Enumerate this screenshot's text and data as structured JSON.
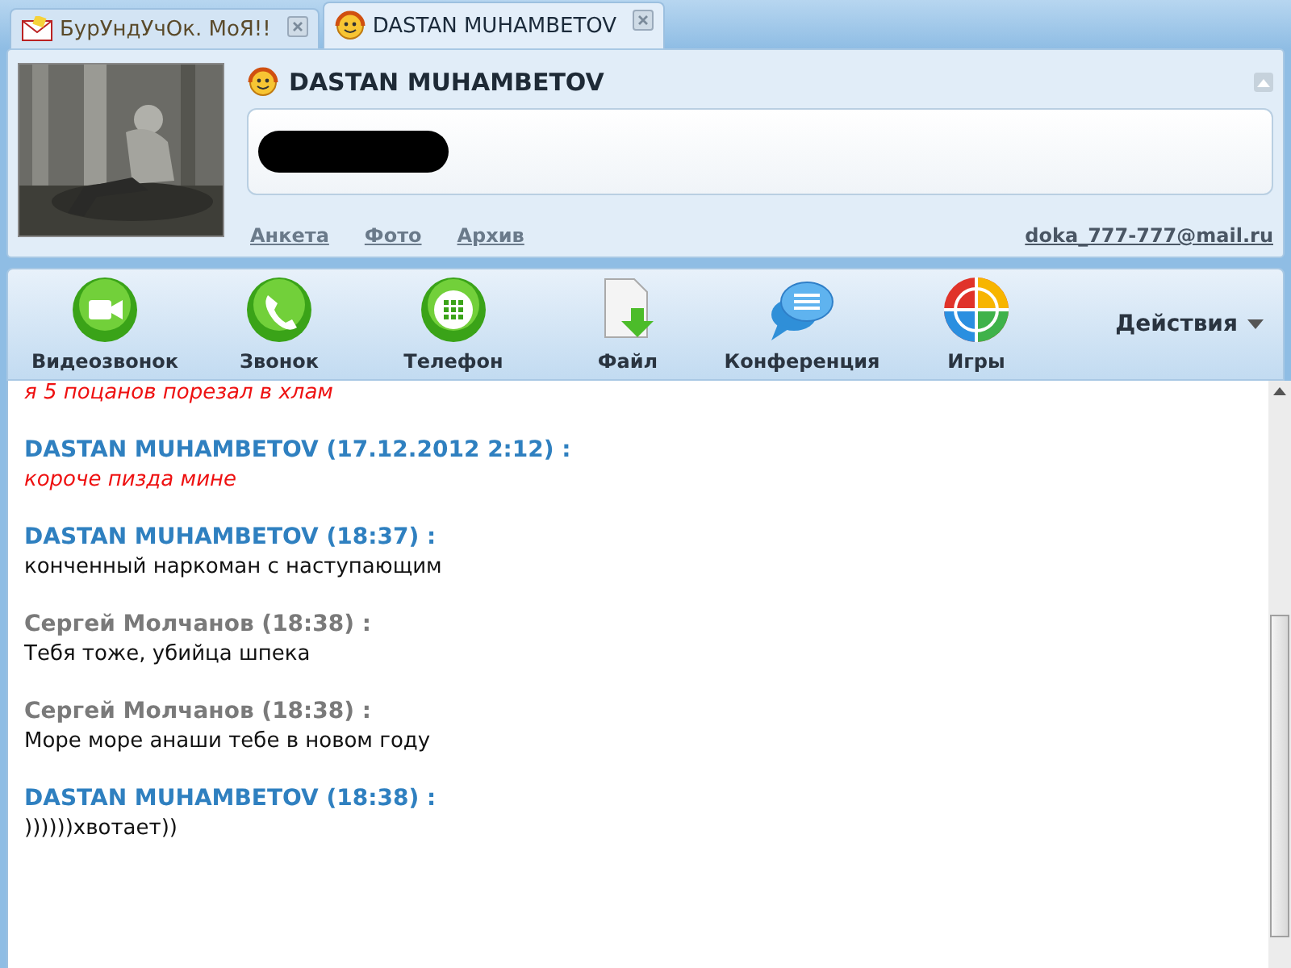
{
  "tabs": [
    {
      "label": "БурУндУчОк. МоЯ!!",
      "selected": false
    },
    {
      "label": "DASTAN MUHAMBETOV",
      "selected": true
    }
  ],
  "contact": {
    "name": "DASTAN MUHAMBETOV",
    "status_redacted": true,
    "links": [
      "Анкета",
      "Фото",
      "Архив"
    ],
    "email": "doka_777-777@mail.ru"
  },
  "toolbar": [
    {
      "label": "Видеозвонок"
    },
    {
      "label": "Звонок"
    },
    {
      "label": "Телефон"
    },
    {
      "label": "Файл"
    },
    {
      "label": "Конференция"
    },
    {
      "label": "Игры"
    }
  ],
  "actions_menu": "Действия",
  "messages": [
    {
      "text": "я 5 поцанов порезал в хлам",
      "highlight": true
    },
    {
      "kind": "contact",
      "header": "DASTAN MUHAMBETOV (17.12.2012 2:12) :",
      "text": "короче пизда мине",
      "highlight": true
    },
    {
      "kind": "contact",
      "header": "DASTAN MUHAMBETOV (18:37) :",
      "text": "конченный наркоман с наступающим",
      "highlight": false
    },
    {
      "kind": "self",
      "header": "Сергей Молчанов (18:38) :",
      "text": "Тебя тоже, убийца шпека",
      "highlight": false
    },
    {
      "kind": "self",
      "header": "Сергей Молчанов (18:38) :",
      "text": "Море море анаши тебе в новом году",
      "highlight": false
    },
    {
      "kind": "contact",
      "header": "DASTAN MUHAMBETOV (18:38) :",
      "text": "))))))хвотает))",
      "highlight": false
    }
  ]
}
